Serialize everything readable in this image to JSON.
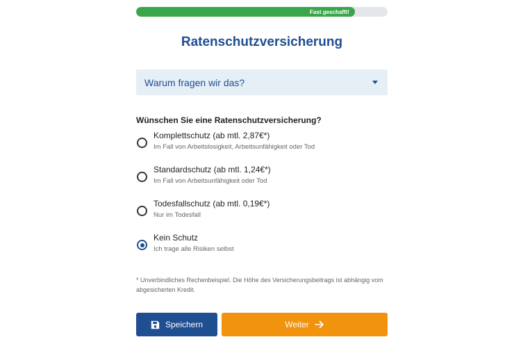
{
  "progress": {
    "label": "Fast geschafft!",
    "percent": 87
  },
  "title": "Ratenschutzversicherung",
  "accordion": {
    "label": "Warum fragen wir das?"
  },
  "question": "Wünschen Sie eine Ratenschutzversicherung?",
  "options": [
    {
      "title": "Komplettschutz (ab mtl. 2,87€*)",
      "subtitle": "Im Fall von Arbeitslosigkeit, Arbeitsunfähigkeit oder Tod",
      "selected": false
    },
    {
      "title": "Standardschutz (ab mtl. 1,24€*)",
      "subtitle": "Im Fall von Arbeitsunfähigkeit oder Tod",
      "selected": false
    },
    {
      "title": "Todesfallschutz (ab mtl. 0,19€*)",
      "subtitle": "Nur im Todesfall",
      "selected": false
    },
    {
      "title": "Kein Schutz",
      "subtitle": "Ich trage alle Risiken selbst",
      "selected": true
    }
  ],
  "footnote": "* Unverbindliches Rechenbeispiel. Die Höhe des Versicherungsbeitrags ist abhängig vom abgesicherten Kredit.",
  "buttons": {
    "save_label": "Speichern",
    "next_label": "Weiter"
  },
  "colors": {
    "primary": "#1f4e91",
    "accent": "#f1930c",
    "progress": "#3aa64b"
  },
  "icons": {
    "save": "floppy-disk-icon",
    "next": "arrow-right-icon",
    "accordion": "caret-down-icon"
  }
}
